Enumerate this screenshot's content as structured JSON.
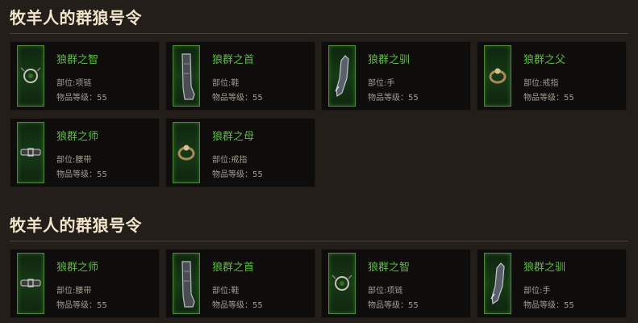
{
  "sections": [
    {
      "title": "牧羊人的群狼号令",
      "items": [
        {
          "name": "狼群之智",
          "slot": "部位:项链",
          "level": "物品等级：55",
          "icon": "amulet-icon"
        },
        {
          "name": "狼群之首",
          "slot": "部位:鞋",
          "level": "物品等级：55",
          "icon": "boots-icon"
        },
        {
          "name": "狼群之驯",
          "slot": "部位:手",
          "level": "物品等级：55",
          "icon": "gloves-icon"
        },
        {
          "name": "狼群之父",
          "slot": "部位:戒指",
          "level": "物品等级：55",
          "icon": "ring-icon"
        },
        {
          "name": "狼群之师",
          "slot": "部位:腰带",
          "level": "物品等级：55",
          "icon": "belt-icon"
        },
        {
          "name": "狼群之母",
          "slot": "部位:戒指",
          "level": "物品等级：55",
          "icon": "ring-icon"
        }
      ]
    },
    {
      "title": "牧羊人的群狼号令",
      "items": [
        {
          "name": "狼群之师",
          "slot": "部位:腰带",
          "level": "物品等级：55",
          "icon": "belt-icon"
        },
        {
          "name": "狼群之首",
          "slot": "部位:鞋",
          "level": "物品等级：55",
          "icon": "boots-icon"
        },
        {
          "name": "狼群之智",
          "slot": "部位:项链",
          "level": "物品等级：55",
          "icon": "amulet-icon"
        },
        {
          "name": "狼群之驯",
          "slot": "部位:手",
          "level": "物品等级：55",
          "icon": "gloves-icon"
        }
      ]
    }
  ],
  "colors": {
    "background": "#231e19",
    "card": "#0f0d0b",
    "item_name": "#5fbb45",
    "item_meta": "#a39c93",
    "title": "#f3e6cc",
    "thumb_border": "#4c8a3a"
  }
}
